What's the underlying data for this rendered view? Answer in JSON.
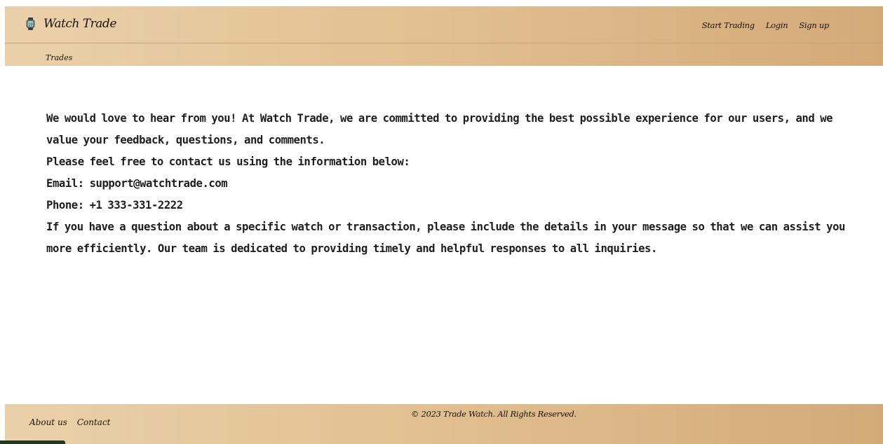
{
  "header": {
    "brand": "Watch Trade",
    "nav": {
      "start_trading": "Start Trading",
      "login": "Login",
      "signup": "Sign up"
    },
    "sub_nav": {
      "trades": "Trades"
    }
  },
  "content": {
    "intro": "We would love to hear from you! At Watch Trade, we are committed to providing the best possible experience for our users, and we value your feedback, questions, and comments.",
    "contact_prompt": "Please feel free to contact us using the information below:",
    "email": "Email: support@watchtrade.com",
    "phone": "Phone: +1 333-331-2222",
    "details": "If you have a question about a specific watch or transaction, please include the details in your message so that we can assist you more efficiently. Our team is dedicated to providing timely and helpful responses to all inquiries."
  },
  "footer": {
    "about": "About us",
    "contact": "Contact",
    "copyright": "© 2023 Trade Watch. All Rights Reserved."
  },
  "colors": {
    "bar_start": "#ead0aa",
    "bar_end": "#d4a978",
    "text": "#1e1e1e",
    "badge": "#1f3b1f"
  },
  "icons": {
    "brand_icon": "watch-icon"
  }
}
